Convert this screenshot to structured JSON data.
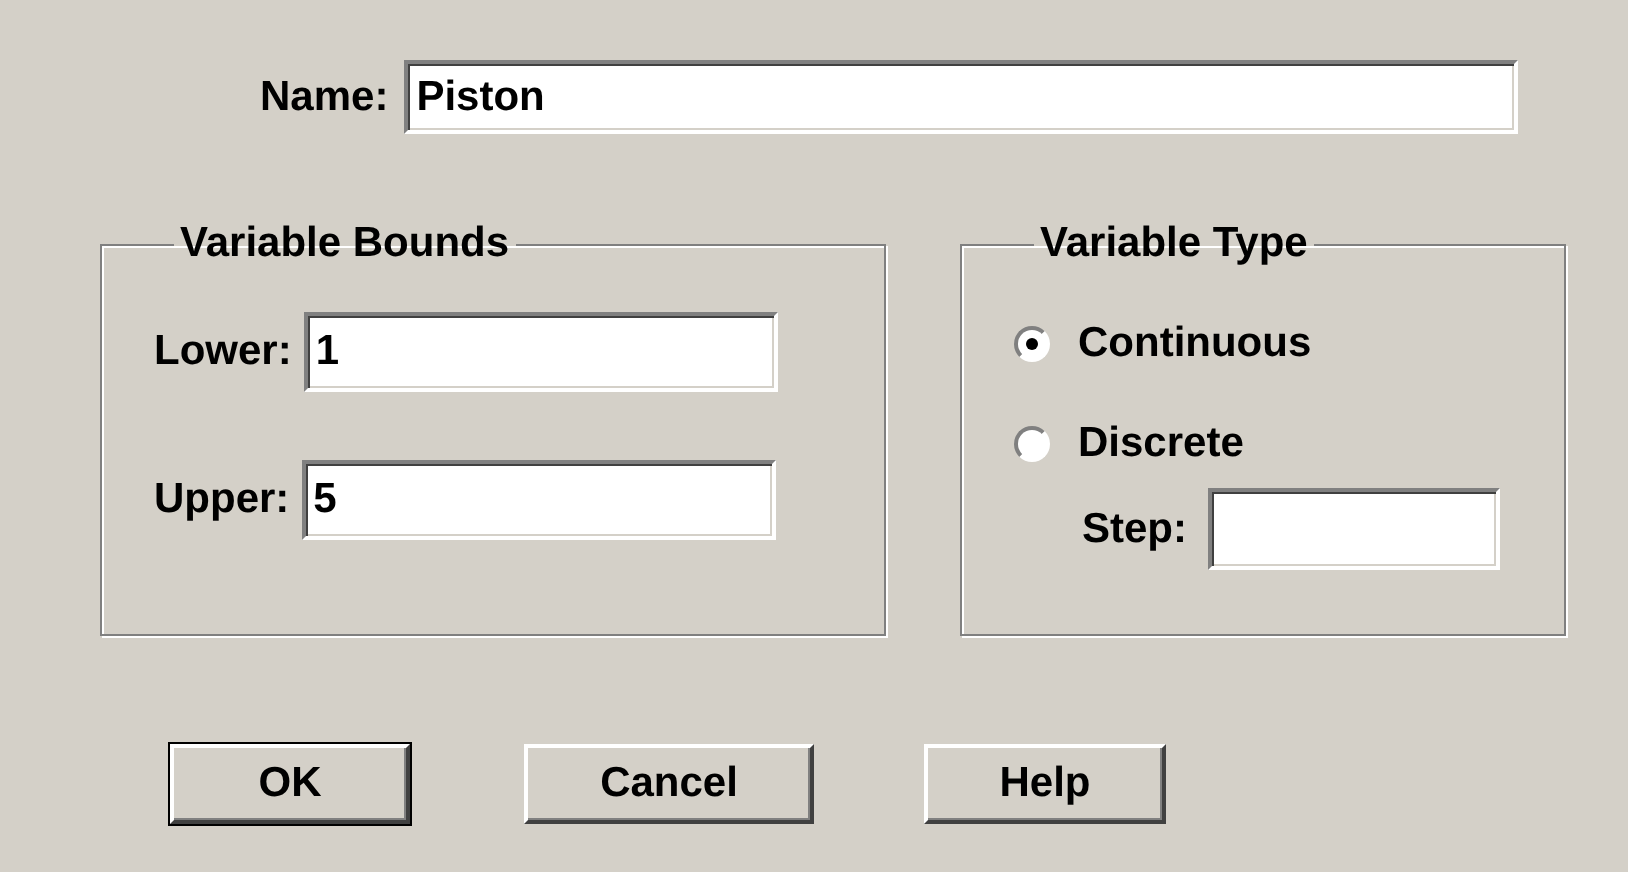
{
  "name": {
    "label": "Name:",
    "value": "Piston"
  },
  "variable_bounds": {
    "title": "Variable Bounds",
    "fields": [
      {
        "label": "Lower:",
        "value": "1"
      },
      {
        "label": "Upper:",
        "value": "5"
      }
    ]
  },
  "variable_type": {
    "title": "Variable Type",
    "options": [
      {
        "label": "Continuous",
        "selected": true
      },
      {
        "label": "Discrete",
        "selected": false
      }
    ],
    "step": {
      "label": "Step:"
    }
  },
  "buttons": [
    {
      "label": "OK",
      "default": true
    },
    {
      "label": "Cancel",
      "default": false
    },
    {
      "label": "Help",
      "default": false
    }
  ]
}
